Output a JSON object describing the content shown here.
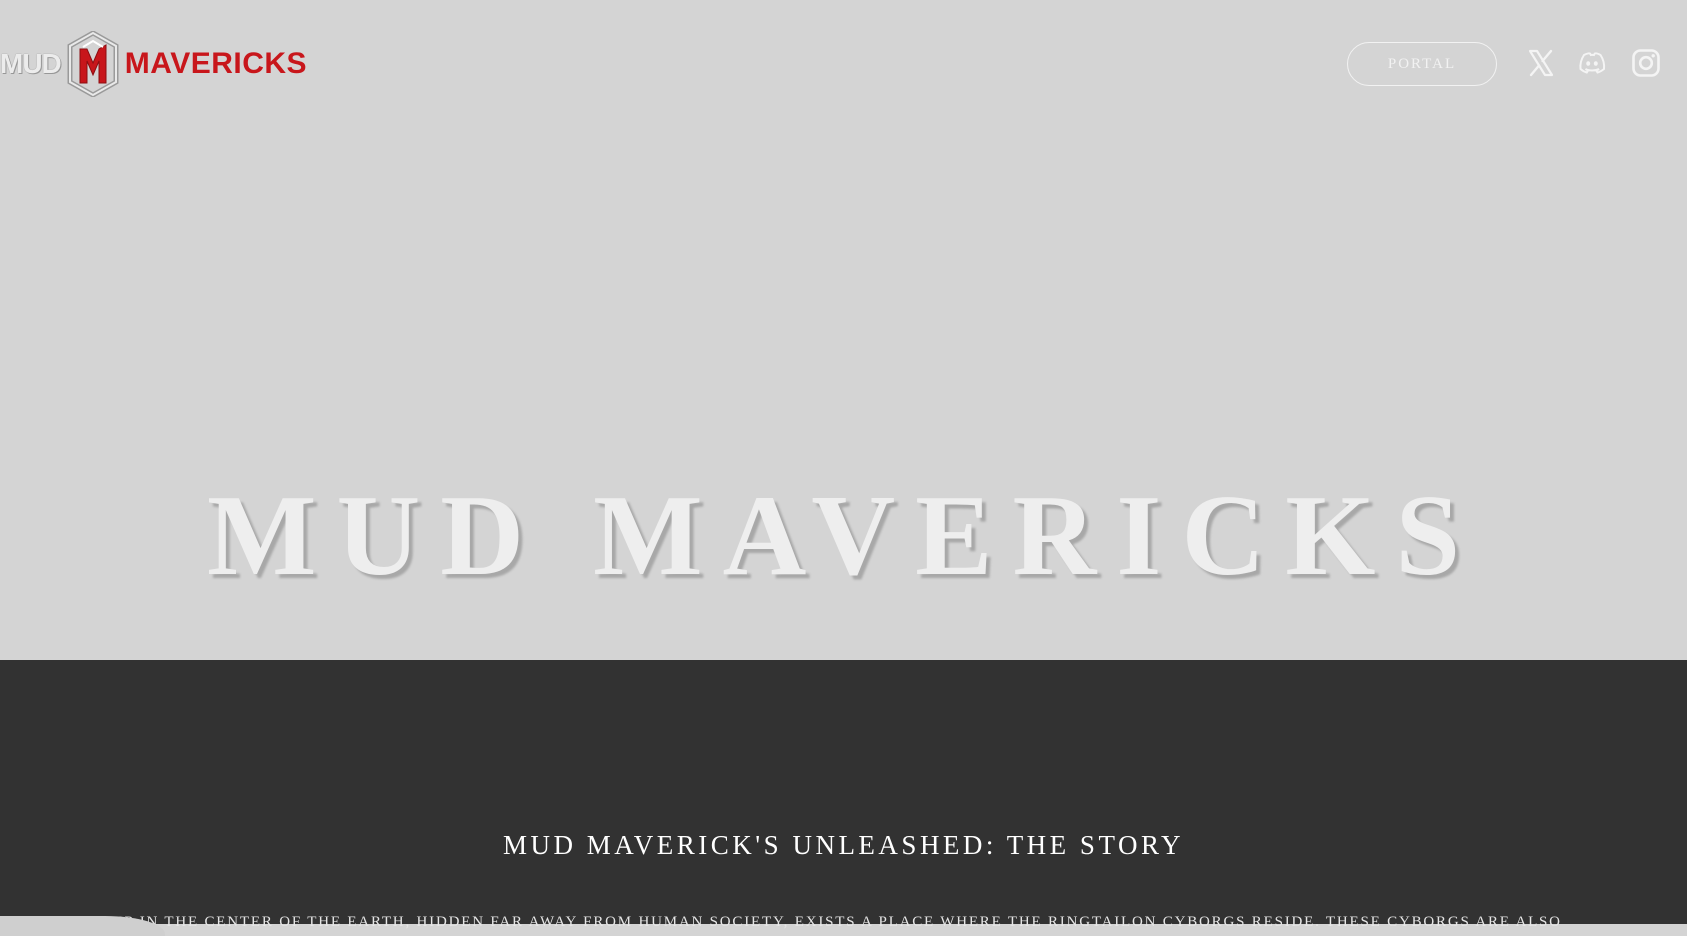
{
  "header": {
    "logo": {
      "text_left": "MUD",
      "text_right": "MAVERICKS",
      "mark_icon": "mm-emblem-icon"
    },
    "portal_label": "PORTAL",
    "social": [
      {
        "icon": "x-twitter-icon"
      },
      {
        "icon": "discord-icon"
      },
      {
        "icon": "instagram-icon"
      }
    ]
  },
  "hero": {
    "title": "MUD MAVERICKS"
  },
  "story": {
    "heading": "MUD MAVERICK'S UNLEASHED: THE STORY",
    "text": "DEEP IN THE CENTER OF THE EARTH, HIDDEN FAR AWAY FROM HUMAN SOCIETY, EXISTS A PLACE WHERE THE RINGTAILON CYBORGS RESIDE. THESE CYBORGS ARE ALSO"
  },
  "colors": {
    "hero_bg": "#d4d4d4",
    "story_bg": "#323232",
    "brand_red": "#c8161b",
    "title_text": "#eeeeee"
  }
}
